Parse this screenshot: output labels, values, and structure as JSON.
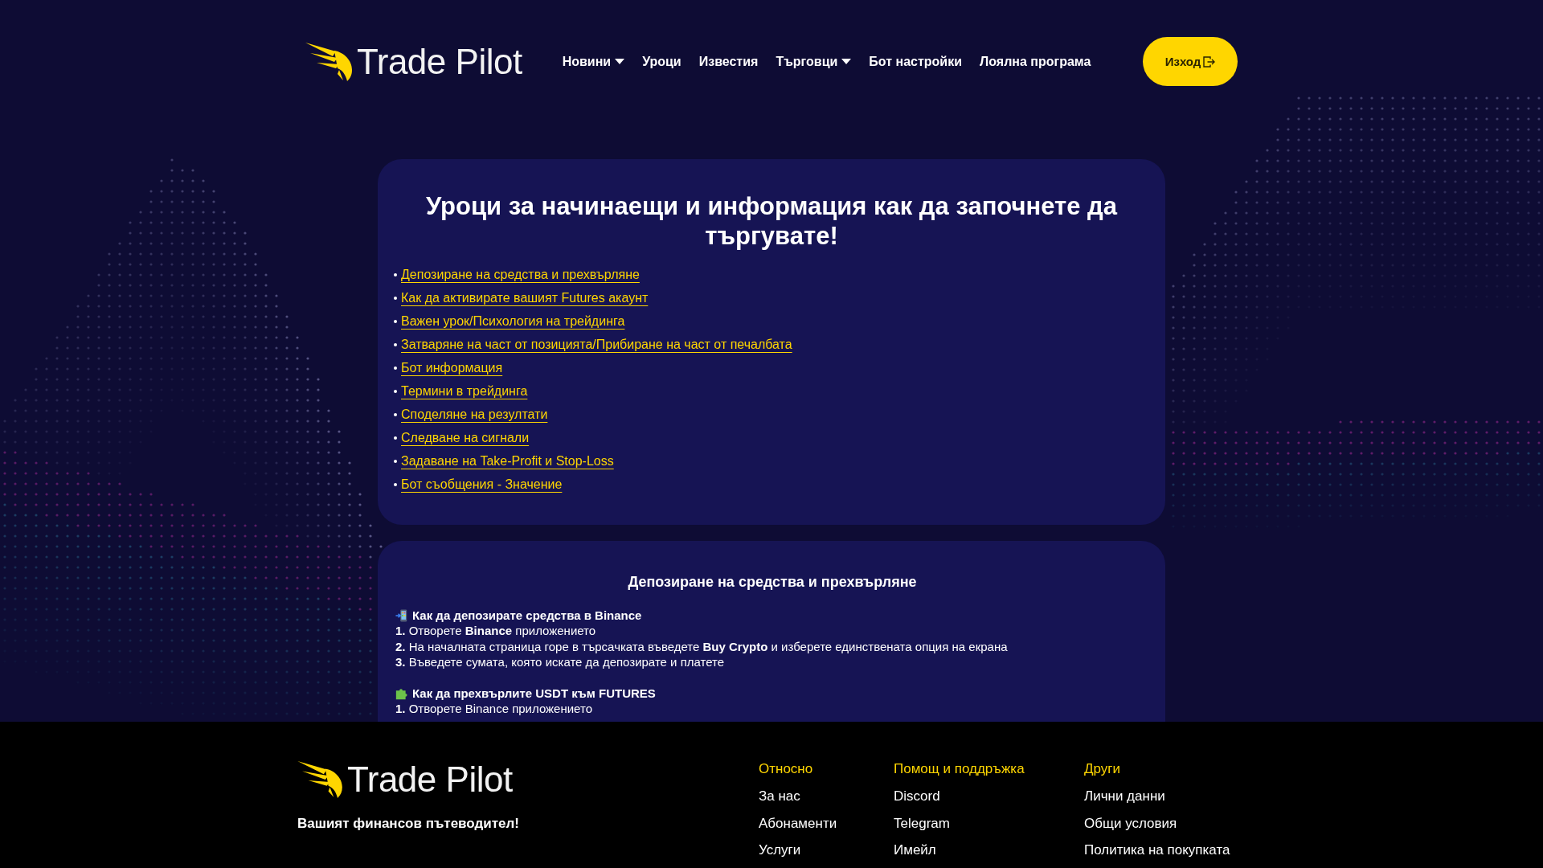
{
  "header": {
    "logo": "Trade Pilot",
    "nav": [
      {
        "label": "Новини",
        "dropdown": true
      },
      {
        "label": "Уроци",
        "dropdown": false
      },
      {
        "label": "Известия",
        "dropdown": false
      },
      {
        "label": "Търговци",
        "dropdown": true
      },
      {
        "label": "Бот настройки",
        "dropdown": false
      },
      {
        "label": "Лоялна програма",
        "dropdown": false
      }
    ],
    "logout_button": "Изход"
  },
  "lessons": {
    "title": "Уроци за начинаещи и информация как да започнете да търгувате!",
    "links": [
      "Депозиране на средства и прехвърляне",
      "Как да активирате вашият Futures акаунт",
      "Важен урок/Психология на трейдинга",
      "Затваряне на част от позицията/Прибиране на част от печалбата",
      "Бот информация",
      "Термини в трейдинга",
      "Споделяне на резултати",
      "Следване на сигнали",
      "Задаване на Take-Profit и Stop-Loss",
      "Бот съобщения - Значение"
    ]
  },
  "section": {
    "title": "Депозиране на средства и прехвърляне",
    "blocks": [
      {
        "kind": "deposit",
        "heading": "Как да депозирате средства в Binance",
        "steps": [
          "**1.** Отворете **Binance** приложението",
          "**2.** На началната страница горе в търсачката въведете **Buy Crypto** и изберете единствената опция на екрана",
          "**3.** Въведете сумата, която искате да депозирате и платете"
        ]
      },
      {
        "kind": "transfer",
        "heading": "Как да прехвърлите USDT към FUTURES",
        "steps": [
          "**1.** Отворете Binance приложението"
        ]
      }
    ]
  },
  "footer": {
    "logo": "Trade Pilot",
    "tagline": "Вашият финансов пътеводител!",
    "columns": [
      {
        "title": "Относно",
        "links": [
          "За нас",
          "Абонаменти",
          "Услуги"
        ]
      },
      {
        "title": "Помощ и поддръжка",
        "links": [
          "Discord",
          "Telegram",
          "Имейл"
        ]
      },
      {
        "title": "Други",
        "links": [
          "Лични данни",
          "Общи условия",
          "Политика на покупката"
        ]
      }
    ]
  }
}
